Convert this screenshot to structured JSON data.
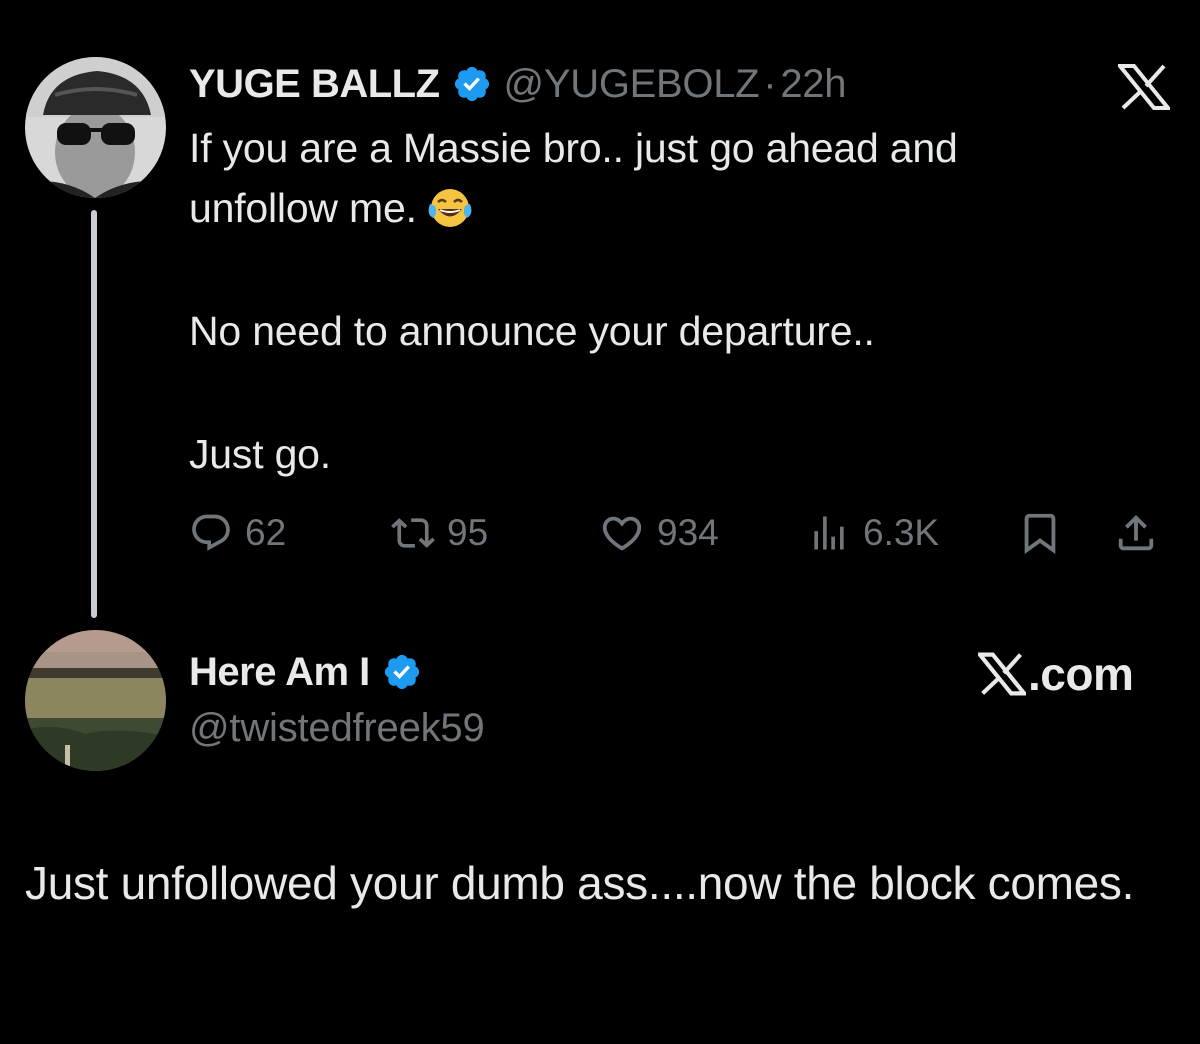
{
  "original_tweet": {
    "display_name": "YUGE BALLZ",
    "verified": true,
    "handle": "@YUGEBOLZ",
    "separator": "·",
    "time": "22h",
    "avatar_icon": "profile-photo-man-with-cap-and-sunglasses",
    "text_lines": [
      "If you are a Massie bro.. just go ahead and",
      "unfollow me.",
      "No need to announce your departure..",
      "Just go."
    ],
    "emoji": "face-with-tears-of-joy",
    "metrics": {
      "replies": "62",
      "retweets": "95",
      "likes": "934",
      "views": "6.3K"
    }
  },
  "quoting_user": {
    "display_name": "Here Am I",
    "verified": true,
    "handle": "@twistedfreek59",
    "avatar_icon": "profile-photo-field-with-cattle"
  },
  "branding": {
    "x_logo": "x-logo-icon",
    "site": ".com"
  },
  "reply_text": "Just unfollowed your dumb ass....now the block comes.",
  "colors": {
    "background": "#000000",
    "text": "#e7e9ea",
    "secondary_text": "#71767b",
    "verified_badge": "#1d9bf0",
    "thread_line": "#c9cdd1"
  }
}
